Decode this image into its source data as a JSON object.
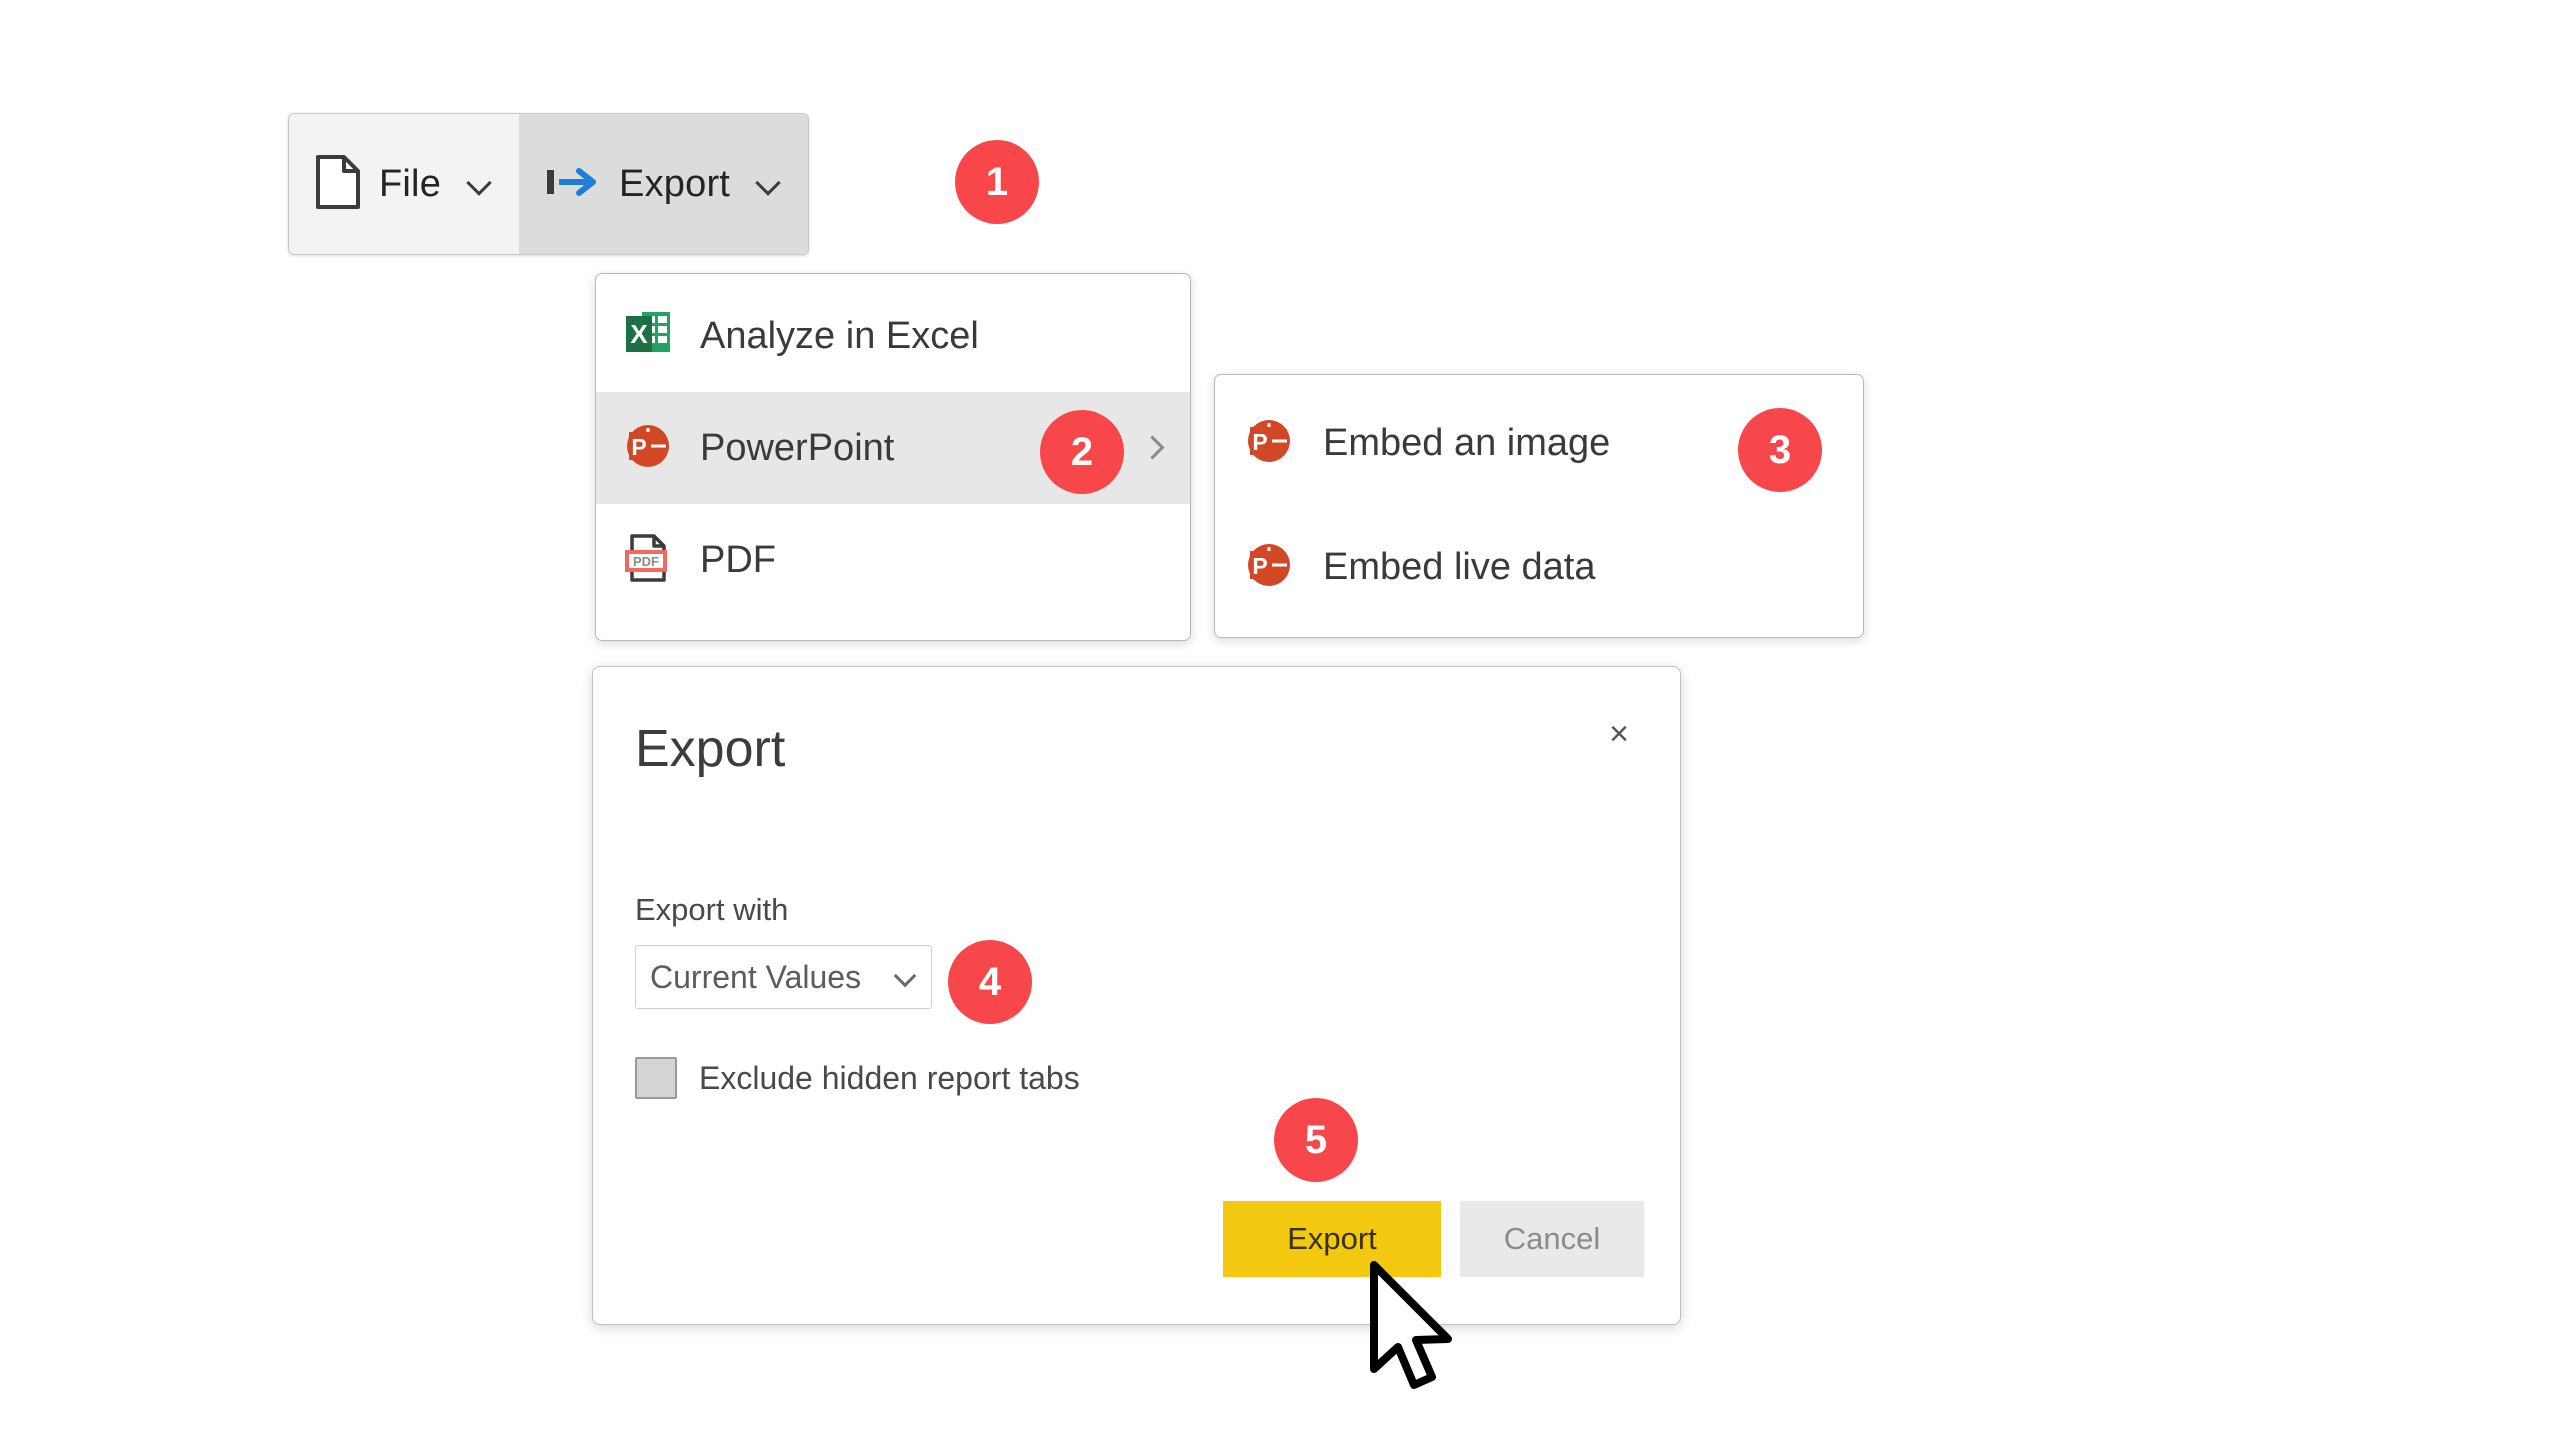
{
  "toolbar": {
    "file": {
      "label": "File",
      "icon": "document-icon",
      "chevron": "chevron-down-icon"
    },
    "export": {
      "label": "Export",
      "icon": "export-arrow-icon",
      "chevron": "chevron-down-icon"
    }
  },
  "menu_main": {
    "items": [
      {
        "label": "Analyze in Excel",
        "icon": "excel-icon",
        "has_submenu": false,
        "highlighted": false
      },
      {
        "label": "PowerPoint",
        "icon": "powerpoint-icon",
        "has_submenu": true,
        "highlighted": true
      },
      {
        "label": "PDF",
        "icon": "pdf-icon",
        "has_submenu": false,
        "highlighted": false
      }
    ]
  },
  "menu_sub": {
    "items": [
      {
        "label": "Embed an image",
        "icon": "powerpoint-icon"
      },
      {
        "label": "Embed live data",
        "icon": "powerpoint-icon"
      }
    ]
  },
  "dialog": {
    "title": "Export",
    "close_label": "×",
    "export_with_label": "Export with",
    "select_value": "Current Values",
    "exclude_label": "Exclude hidden report tabs",
    "exclude_checked": false,
    "export_button": "Export",
    "cancel_button": "Cancel"
  },
  "badges": {
    "b1": "1",
    "b2": "2",
    "b3": "3",
    "b4": "4",
    "b5": "5",
    "color": "#F8474A"
  },
  "colors": {
    "accent_yellow": "#F2C811",
    "excel_green": "#1D7044",
    "powerpoint_orange": "#D24726",
    "pdf_red": "#F4685F",
    "export_blue": "#1F7FD4",
    "badge_red": "#F8474A"
  },
  "cursor": {
    "icon": "mouse-pointer-icon"
  }
}
